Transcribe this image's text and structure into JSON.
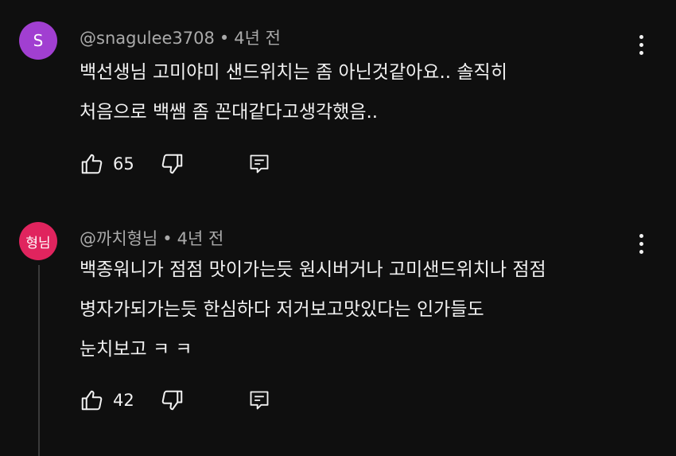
{
  "comments": [
    {
      "avatar_text": "S",
      "avatar_color": "#a13fd1",
      "author": "@snagulee3708",
      "separator": "•",
      "time": "4년 전",
      "lines": [
        "백선생님 고미야미 샌드위치는 좀 아닌것같아요.. 솔직히",
        "처음으로 백쌤 좀 꼰대같다고생각했음.."
      ],
      "likes": "65",
      "icons": {
        "like": "thumbs-up-icon",
        "dislike": "thumbs-down-icon",
        "reply": "reply-icon",
        "more": "more-vertical-icon"
      }
    },
    {
      "avatar_text": "형님",
      "avatar_color": "#e0245e",
      "author": "@까치형님",
      "separator": "•",
      "time": "4년 전",
      "lines": [
        "백종워니가 점점 맛이가는듯 원시버거나  고미샌드위치나 점점",
        "병자가되가는듯 한심하다 저거보고맛있다는 인가들도",
        "눈치보고 ㅋ ㅋ"
      ],
      "likes": "42",
      "icons": {
        "like": "thumbs-up-icon",
        "dislike": "thumbs-down-icon",
        "reply": "reply-icon",
        "more": "more-vertical-icon"
      }
    }
  ]
}
